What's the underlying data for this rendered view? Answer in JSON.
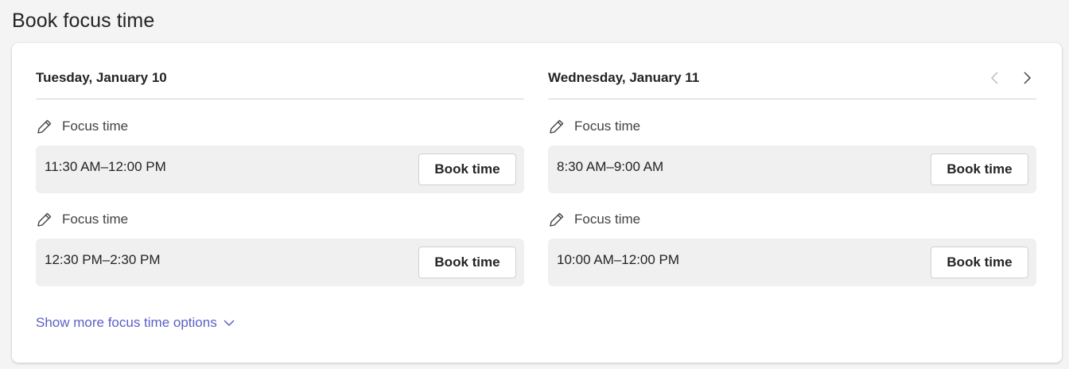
{
  "page": {
    "title": "Book focus time"
  },
  "days": [
    {
      "title": "Tuesday, January 10",
      "slots": [
        {
          "label": "Focus time",
          "time": "11:30 AM–12:00 PM",
          "button": "Book time"
        },
        {
          "label": "Focus time",
          "time": "12:30 PM–2:30 PM",
          "button": "Book time"
        }
      ]
    },
    {
      "title": "Wednesday, January 11",
      "slots": [
        {
          "label": "Focus time",
          "time": "8:30 AM–9:00 AM",
          "button": "Book time"
        },
        {
          "label": "Focus time",
          "time": "10:00 AM–12:00 PM",
          "button": "Book time"
        }
      ]
    }
  ],
  "navigation": {
    "prev_icon": "chevron-left-icon",
    "next_icon": "chevron-right-icon"
  },
  "show_more": {
    "label": "Show more focus time options",
    "icon": "chevron-down-icon"
  },
  "colors": {
    "link": "#5b5fc7",
    "slot_bg": "#f0f0f0",
    "page_bg": "#f4f4f4"
  }
}
